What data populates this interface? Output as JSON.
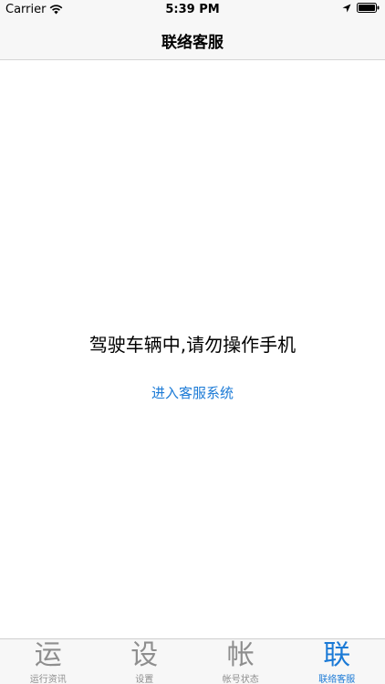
{
  "status_bar": {
    "carrier": "Carrier",
    "time": "5:39 PM"
  },
  "nav": {
    "title": "联络客服"
  },
  "main": {
    "warning": "驾驶车辆中,请勿操作手机",
    "link": "进入客服系统"
  },
  "tabs": [
    {
      "glyph": "运",
      "label": "运行资讯",
      "active": false
    },
    {
      "glyph": "设",
      "label": "设置",
      "active": false
    },
    {
      "glyph": "帐",
      "label": "帐号状态",
      "active": false
    },
    {
      "glyph": "联",
      "label": "联络客服",
      "active": true
    }
  ],
  "colors": {
    "accent": "#1b7ad6",
    "inactive": "#8e8e8e",
    "bar_background": "#f7f7f7"
  }
}
